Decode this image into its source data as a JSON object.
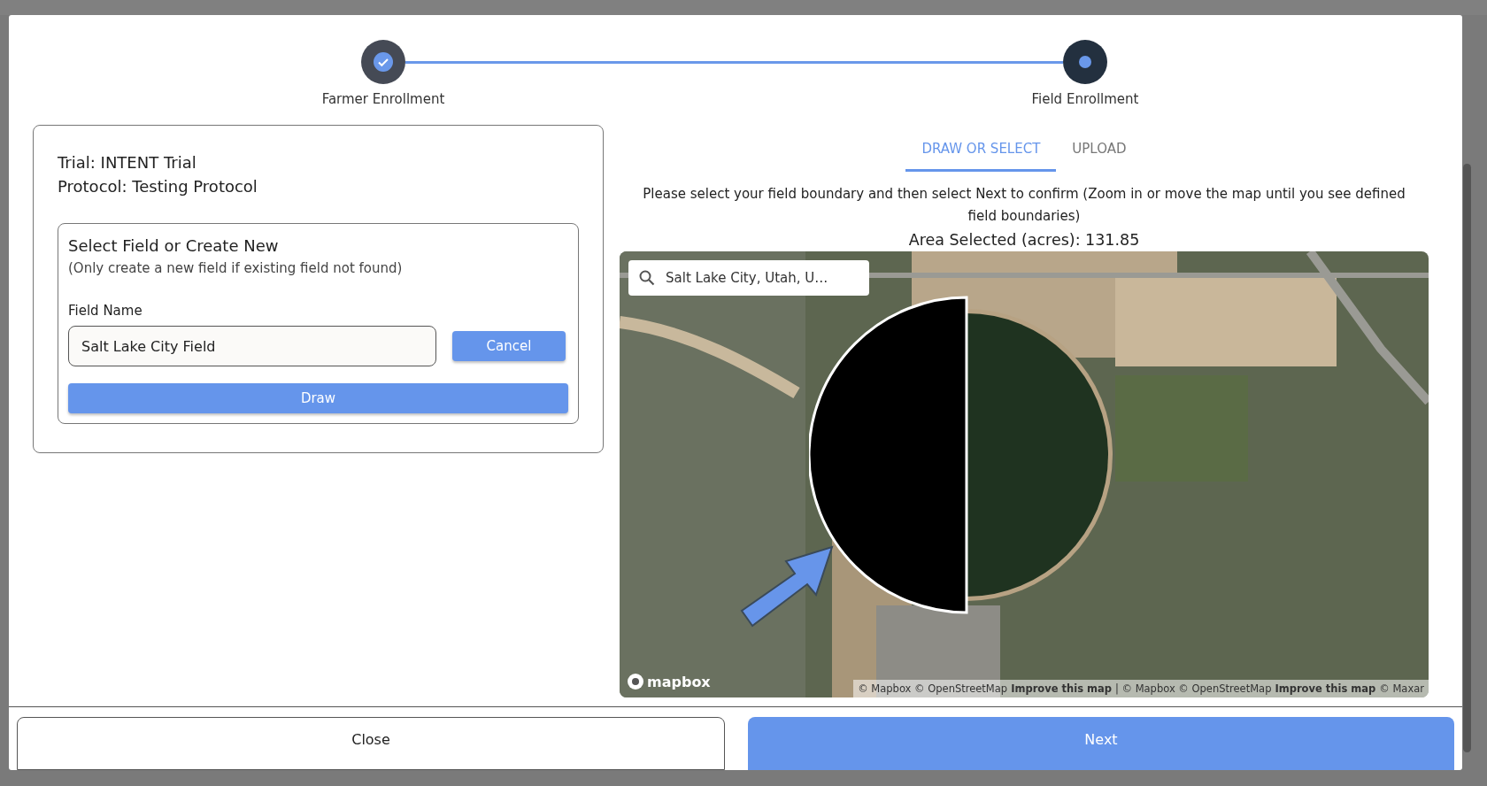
{
  "stepper": {
    "steps": [
      {
        "label": "Farmer Enrollment",
        "completed": true
      },
      {
        "label": "Field Enrollment",
        "completed": false
      }
    ]
  },
  "trial_info": {
    "trial": "Trial: INTENT Trial",
    "protocol": "Protocol: Testing Protocol"
  },
  "field_form": {
    "title": "Select Field or Create New",
    "note": "(Only create a new field if existing field not found)",
    "field_label": "Field Name",
    "field_value": "Salt Lake City Field",
    "cancel_button": "Cancel",
    "draw_button": "Draw"
  },
  "tabs": [
    {
      "label": "DRAW OR SELECT",
      "selected": true
    },
    {
      "label": "UPLOAD",
      "selected": false
    }
  ],
  "instructions": "Please select your field boundary and then select Next to confirm (Zoom in or move the map until you see defined field boundaries)",
  "area_selected": "Area Selected (acres): 131.85",
  "map": {
    "kind": "picture",
    "search_value": "Salt Lake City, Utah, U…",
    "logo": "mapbox",
    "attribution": [
      {
        "kind": "text",
        "text": "© Mapbox © OpenStreetMap"
      },
      {
        "kind": "link",
        "text": "Improve this map"
      },
      {
        "kind": "text",
        "text": "| © Mapbox © OpenStreetMap"
      },
      {
        "kind": "link",
        "text": "Improve this map"
      },
      {
        "kind": "text",
        "text": "© Maxar"
      }
    ]
  },
  "footer": {
    "close_button": "Close",
    "next_button": "Next"
  }
}
